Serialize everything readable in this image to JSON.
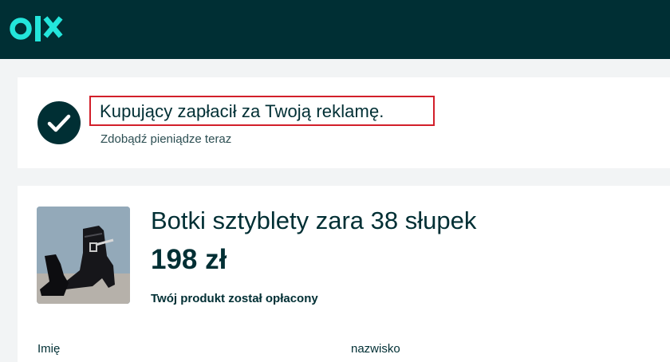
{
  "header": {
    "logo_text": "olx",
    "logo_icon": "olx-logo"
  },
  "notice": {
    "icon": "check-icon",
    "title": "Kupujący zapłacił za Twoją reklamę.",
    "subtitle": "Zdobądź pieniądze teraz",
    "highlight_color": "#d21f2a"
  },
  "product": {
    "image_icon": "boot-photo",
    "title": "Botki sztyblety zara 38 słupek",
    "price": "198 zł",
    "status": "Twój produkt został opłacony"
  },
  "form": {
    "first_name_label": "Imię",
    "last_name_label": "nazwisko"
  },
  "colors": {
    "brand": "#002f34",
    "accent": "#23e5db",
    "background": "#f2f4f5"
  }
}
